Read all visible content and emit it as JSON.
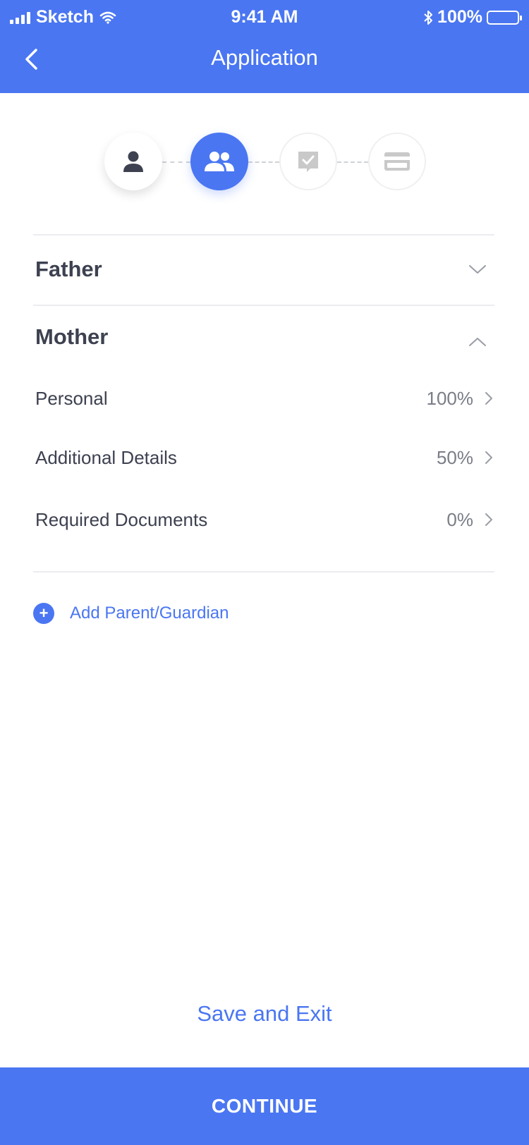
{
  "status_bar": {
    "carrier": "Sketch",
    "time": "9:41 AM",
    "battery": "100%",
    "icons": [
      "signal-icon",
      "wifi-icon",
      "bluetooth-icon",
      "battery-icon"
    ]
  },
  "header": {
    "title": "Application",
    "back_icon": "chevron-left-icon"
  },
  "stepper": {
    "steps": [
      {
        "icon": "person-icon",
        "state": "done"
      },
      {
        "icon": "people-icon",
        "state": "active"
      },
      {
        "icon": "checkbox-icon",
        "state": "pending"
      },
      {
        "icon": "credit-card-icon",
        "state": "pending"
      }
    ]
  },
  "sections": {
    "father": {
      "title": "Father",
      "expanded": false
    },
    "mother": {
      "title": "Mother",
      "expanded": true
    }
  },
  "mother_items": [
    {
      "label": "Personal",
      "progress": "100%"
    },
    {
      "label": "Additional Details",
      "progress": "50%"
    },
    {
      "label": "Required Documents",
      "progress": "0%"
    }
  ],
  "add_parent": {
    "label": "Add Parent/Guardian",
    "icon": "plus-circle-icon"
  },
  "footer": {
    "save_exit_label": "Save and Exit",
    "continue_label": "CONTINUE"
  },
  "colors": {
    "accent": "#4a76f2",
    "text": "#3d4150",
    "muted": "#7a7d86"
  }
}
